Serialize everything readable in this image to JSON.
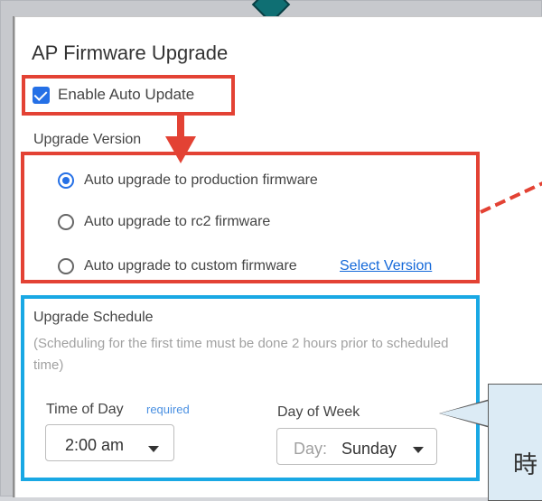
{
  "title": "AP Firmware Upgrade",
  "enable_auto_update": {
    "label": "Enable Auto Update",
    "checked": true
  },
  "upgrade_version": {
    "label": "Upgrade Version",
    "options": [
      {
        "label": "Auto upgrade to production firmware",
        "selected": true
      },
      {
        "label": "Auto upgrade to rc2 firmware",
        "selected": false
      },
      {
        "label": "Auto upgrade to custom firmware",
        "selected": false
      }
    ],
    "select_version_link": "Select Version"
  },
  "upgrade_schedule": {
    "title": "Upgrade Schedule",
    "note": "(Scheduling for the first time must be done 2 hours prior to scheduled time)",
    "time_of_day": {
      "label": "Time of Day",
      "required": "required",
      "value": "2:00 am"
    },
    "day_of_week": {
      "label": "Day of Week",
      "prefix": "Day:",
      "value": "Sunday"
    }
  },
  "callout": {
    "text": "時"
  },
  "colors": {
    "highlight_red": "#e34234",
    "highlight_blue": "#19a8e4",
    "accent_blue": "#2570e6",
    "link_blue": "#1368d9"
  },
  "icons": [
    "checkbox-checked",
    "radio-selected",
    "radio-unselected",
    "chevron-down-icon",
    "arrow-down-icon"
  ]
}
